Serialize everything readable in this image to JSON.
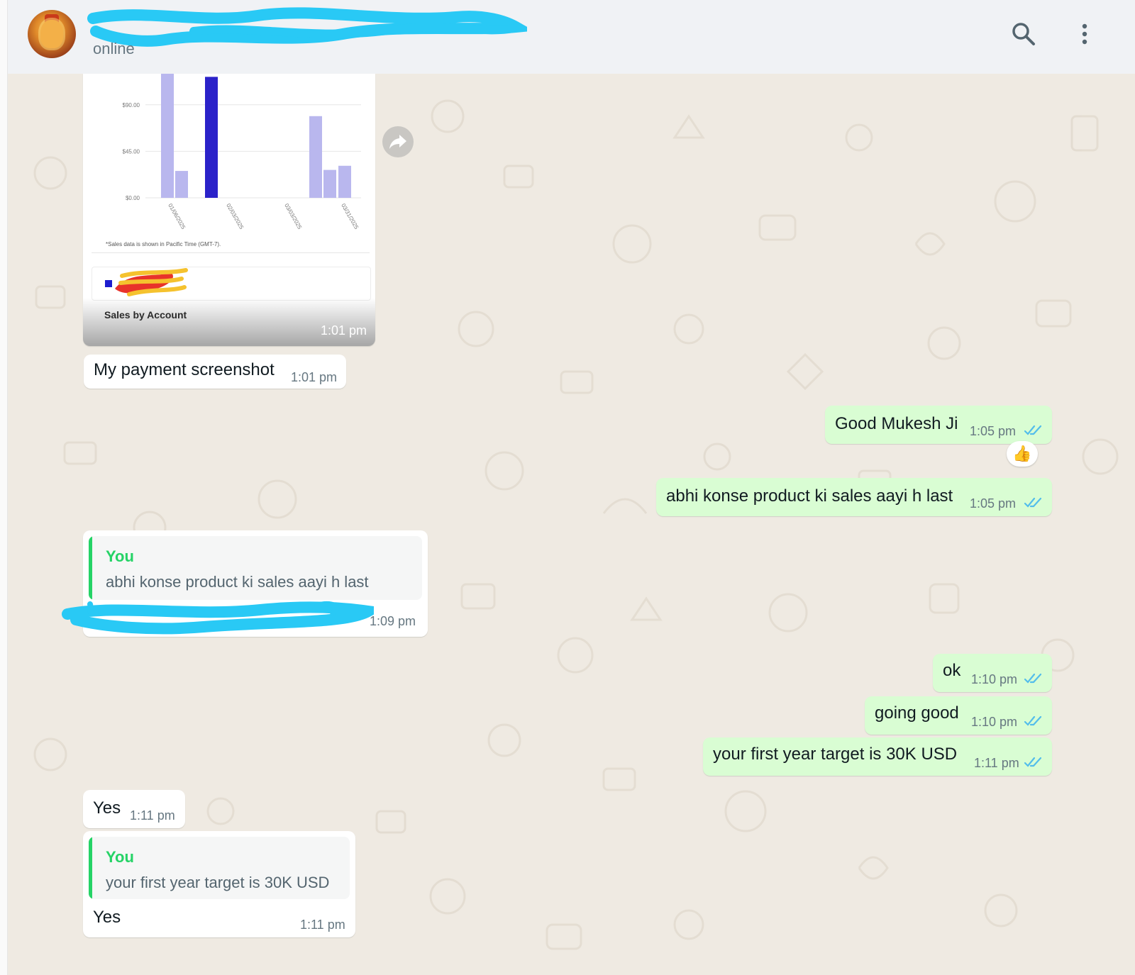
{
  "header": {
    "status": "online",
    "search_icon": "search-icon",
    "menu_icon": "kebab-menu-icon"
  },
  "colors": {
    "header_bg": "#f0f2f5",
    "chat_bg": "#efeae2",
    "incoming_bubble": "#ffffff",
    "outgoing_bubble": "#d9fdd3",
    "read_ticks": "#53bdeb",
    "quote_accent": "#25d366",
    "redaction": "#29c9f5"
  },
  "image_message": {
    "caption": "Sales by Account",
    "time": "1:01 pm",
    "chart_note": "*Sales data is shown in Pacific Time (GMT-7).",
    "forward_icon": "forward-icon"
  },
  "chart_data": {
    "type": "bar",
    "title": "",
    "ylabel": "",
    "xlabel": "",
    "ylim": [
      0,
      120
    ],
    "y_ticks": [
      "$0.00",
      "$45.00",
      "$90.00"
    ],
    "y_tick_values": [
      0,
      45,
      90
    ],
    "x_ticks": [
      "01/06/2025",
      "02/03/2025",
      "03/03/2025",
      "03/31/2025"
    ],
    "bars": [
      {
        "value": 130,
        "highlight": false
      },
      {
        "value": 26,
        "highlight": false
      },
      {
        "value": 117,
        "highlight": true
      },
      {
        "value": 79,
        "highlight": false
      },
      {
        "value": 27,
        "highlight": false
      },
      {
        "value": 31,
        "highlight": false
      }
    ],
    "grid": true
  },
  "messages": [
    {
      "id": "m1",
      "direction": "in",
      "text": "My payment screenshot",
      "time": "1:01 pm"
    },
    {
      "id": "m2",
      "direction": "out",
      "text": "Good Mukesh Ji",
      "time": "1:05 pm",
      "reaction": "👍"
    },
    {
      "id": "m3",
      "direction": "out",
      "text": "abhi konse product ki sales aayi h last",
      "time": "1:05 pm"
    },
    {
      "id": "m4",
      "direction": "in",
      "quote_author": "You",
      "quote_text": "abhi konse product ki sales aayi h last",
      "time": "1:09 pm"
    },
    {
      "id": "m5",
      "direction": "out",
      "text": "ok",
      "time": "1:10 pm"
    },
    {
      "id": "m6",
      "direction": "out",
      "text": "going good",
      "time": "1:10 pm"
    },
    {
      "id": "m7",
      "direction": "out",
      "text": "your first year target is 30K USD",
      "time": "1:11 pm"
    },
    {
      "id": "m8",
      "direction": "in",
      "text": "Yes",
      "time": "1:11 pm"
    },
    {
      "id": "m9",
      "direction": "in",
      "quote_author": "You",
      "quote_text": "your first year target is 30K USD",
      "text": "Yes",
      "time": "1:11 pm"
    }
  ]
}
